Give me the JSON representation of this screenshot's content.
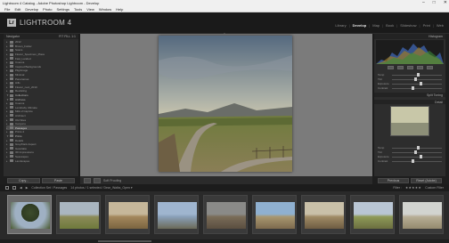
{
  "window": {
    "title": "Lightroom 4 Catalog - Adobe Photoshop Lightroom - Develop",
    "controls": [
      "–",
      "□",
      "✕"
    ]
  },
  "menu": [
    "File",
    "Edit",
    "Develop",
    "Photo",
    "Settings",
    "Tools",
    "View",
    "Window",
    "Help"
  ],
  "identity": {
    "badge": "Lr",
    "app_name": "LIGHTROOM 4"
  },
  "modules": [
    "Library",
    "Develop",
    "Map",
    "Book",
    "Slideshow",
    "Print",
    "Web"
  ],
  "active_module": "Develop",
  "left_panel": {
    "navigator_label": "Navigator",
    "navigator_zoom": "FIT  FILL  1:1",
    "rows": [
      {
        "label": "2012",
        "type": "folder",
        "count": ""
      },
      {
        "label": "Brown_Folder",
        "type": "folder",
        "count": ""
      },
      {
        "label": "Scans",
        "type": "folder",
        "count": ""
      },
      {
        "label": "Flower_Specimen_Place",
        "type": "folder",
        "count": ""
      },
      {
        "label": "Fast_Landed",
        "type": "folder",
        "count": ""
      },
      {
        "label": "Cuenca",
        "type": "folder",
        "count": ""
      },
      {
        "label": "Inspired Backgrounds",
        "type": "folder",
        "count": ""
      },
      {
        "label": "Pilgrimage",
        "type": "folder",
        "count": ""
      },
      {
        "label": "Minimal",
        "type": "folder",
        "count": ""
      },
      {
        "label": "Panoramas",
        "type": "folder",
        "count": ""
      },
      {
        "label": "Hills",
        "type": "folder",
        "count": ""
      },
      {
        "label": "Flower_next_2010",
        "type": "folder",
        "count": ""
      },
      {
        "label": "Revisiting",
        "type": "folder",
        "count": ""
      },
      {
        "label": "Collections",
        "type": "header",
        "count": ""
      },
      {
        "label": "Archives",
        "type": "header",
        "count": ""
      },
      {
        "label": "Cuenca",
        "type": "folder",
        "count": ""
      },
      {
        "label": "Lensbaby Ultimate",
        "type": "folder",
        "count": ""
      },
      {
        "label": "Milk of Caprice",
        "type": "folder",
        "count": ""
      },
      {
        "label": "Architect",
        "type": "folder",
        "count": ""
      },
      {
        "label": "Old Sites",
        "type": "folder",
        "count": ""
      },
      {
        "label": "Canyons",
        "type": "folder",
        "count": ""
      },
      {
        "label": "Passages",
        "type": "folder",
        "count": "",
        "selected": true
      },
      {
        "label": "Prints 2",
        "type": "folder",
        "count": ""
      },
      {
        "label": "Prints",
        "type": "header",
        "count": ""
      },
      {
        "label": "Details",
        "type": "folder",
        "count": ""
      },
      {
        "label": "Grey/Dark Aspect",
        "type": "folder",
        "count": ""
      },
      {
        "label": "Gesolatia",
        "type": "folder",
        "count": ""
      },
      {
        "label": "3D Impressions",
        "type": "folder",
        "count": ""
      },
      {
        "label": "Seascapes",
        "type": "folder",
        "count": ""
      },
      {
        "label": "Landscapes",
        "type": "folder",
        "count": ""
      }
    ],
    "copy_button": "Copy...",
    "paste_button": "Paste"
  },
  "toolbar": {
    "label": "Soft Proofing"
  },
  "right_panel": {
    "histogram_label": "Histogram",
    "sliders": [
      {
        "label": "Temp",
        "value": 0.5
      },
      {
        "label": "Tint",
        "value": 0.45
      },
      {
        "label": "Exposure",
        "value": 0.55
      },
      {
        "label": "Contrast",
        "value": 0.4
      }
    ],
    "sections": [
      "Split Toning",
      "Detail"
    ],
    "prev_button": "Previous",
    "reset_button": "Reset (Adobe)"
  },
  "filmstrip_bar": {
    "path": "Collection Set / Passages",
    "info": "14 photos / 1 selected / Dear_Walks_Open ▾",
    "filter_label": "Filter :",
    "stars": "★★★★★",
    "filter_state": "Custom Filter"
  },
  "thumbs_count": 9,
  "colors": {
    "sky_top": "#5d6f88",
    "sky_bottom": "#d9d2b4",
    "hills": "#6b6d66",
    "field": "#7a8a42",
    "road": "#8a8070"
  }
}
